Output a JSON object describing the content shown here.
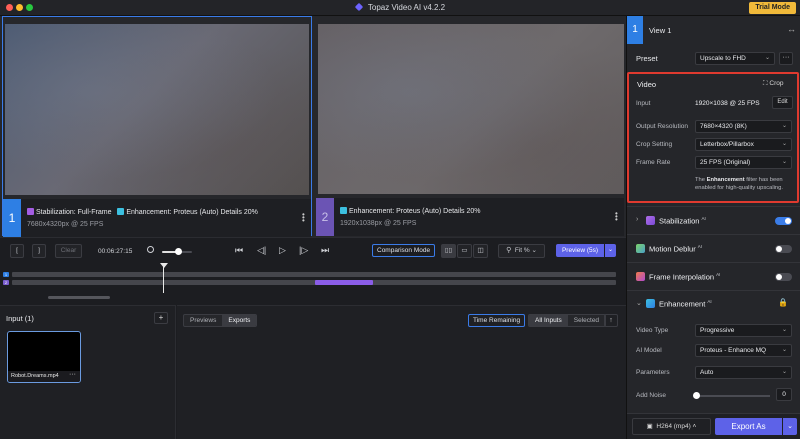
{
  "window": {
    "title": "Topaz Video AI  v4.2.2",
    "trial_label": "Trial Mode"
  },
  "preview": {
    "left": {
      "number": "1",
      "filters": "Stabilization: Full-Frame",
      "filters2": "Enhancement: Proteus (Auto) Details 20%",
      "resolution": "7680x4320px @ 25 FPS"
    },
    "right": {
      "number": "2",
      "filters": "Enhancement: Proteus (Auto) Details 20%",
      "resolution": "1920x1038px @ 25 FPS"
    }
  },
  "controls": {
    "mark_in": "[",
    "mark_out": "]",
    "clear": "Clear",
    "timecode": "00:06:27:15",
    "comparison_mode": "Comparison Mode",
    "fit": "Fit %",
    "preview_button": "Preview (5s)"
  },
  "timeline": {
    "track1_label": "1",
    "track2_label": "2"
  },
  "input_panel": {
    "title": "Input (1)",
    "add_label": "+",
    "thumbnail_name": "Robot.Dreams.mp4"
  },
  "exports_panel": {
    "tabs": [
      "Previews",
      "Exports"
    ],
    "active_tab": "Exports",
    "time_remaining": "Time Remaining",
    "filter_tabs": [
      "All Inputs",
      "Selected"
    ],
    "active_filter": "All Inputs"
  },
  "right_panel": {
    "view_label": "View 1",
    "view_number": "1",
    "preset_label": "Preset",
    "preset_value": "Upscale to FHD",
    "video": {
      "title": "Video",
      "crop_label": "Crop",
      "input_label": "Input",
      "input_value": "1920×1038 @ 25 FPS",
      "edit_label": "Edit",
      "output_resolution_label": "Output Resolution",
      "output_resolution_value": "7680×4320 (8K)",
      "crop_setting_label": "Crop Setting",
      "crop_setting_value": "Letterbox/Pillarbox",
      "frame_rate_label": "Frame Rate",
      "frame_rate_value": "25 FPS (Original)",
      "note_bold": "Enhancement",
      "note_rest": " filter has been enabled for high-quality upscaling.",
      "note_prefix": "The "
    },
    "stabilization": {
      "title": "Stabilization",
      "ai": "AI",
      "enabled": true
    },
    "motion_deblur": {
      "title": "Motion Deblur",
      "ai": "AI",
      "enabled": false
    },
    "frame_interpolation": {
      "title": "Frame Interpolation",
      "ai": "AI",
      "enabled": false
    },
    "enhancement": {
      "title": "Enhancement",
      "ai": "AI",
      "video_type_label": "Video Type",
      "video_type_value": "Progressive",
      "ai_model_label": "AI Model",
      "ai_model_value": "Proteus - Enhance MQ",
      "parameters_label": "Parameters",
      "parameters_value": "Auto",
      "add_noise_label": "Add Noise",
      "add_noise_value": "0"
    },
    "footer": {
      "codec": "H264 (mp4)",
      "export_label": "Export As"
    }
  },
  "colors": {
    "accent_blue": "#3a7be8",
    "accent_purple": "#6b54b4",
    "highlight_red": "#e03a2f",
    "trial_yellow": "#f0b93a"
  }
}
